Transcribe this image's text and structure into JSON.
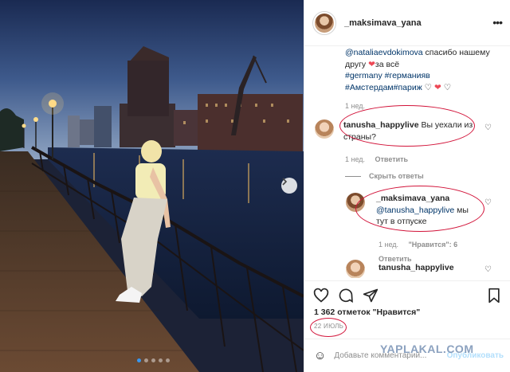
{
  "post": {
    "username": "_maksimava_yana",
    "more_icon": "ellipsis-icon",
    "carousel_next_icon": "chevron-right-icon",
    "carousel_dots": 5,
    "carousel_active": 1
  },
  "caption": {
    "mention": "@nataliaevdokimova",
    "text1": " спасибо нашему другу ",
    "text2": "за всё",
    "tag1": "#germany",
    "tag2": "#германия",
    "tag2_tail": "в",
    "tag3": "#Амстердам",
    "tag4": "#париж",
    "time": "1 нед."
  },
  "comment1": {
    "user": "tanusha_happylive",
    "text": " Вы уехали из страны?",
    "time": "1 нед.",
    "reply": "Ответить"
  },
  "hide_replies": "Скрыть ответы",
  "reply1": {
    "user": "_maksimava_yana",
    "mention": "@tanusha_happylive",
    "text": " мы тут в отпуске",
    "time": "1 нед.",
    "likes": "\"Нравится\": 6",
    "reply": "Ответить"
  },
  "comment2": {
    "user": "tanusha_happylive"
  },
  "stats": {
    "likes": "1 362 отметок \"Нравится\"",
    "date": "22 ИЮЛЬ"
  },
  "add_comment": {
    "placeholder": "Добавьте комментарий...",
    "publish": "Опубликовать"
  },
  "watermark": "YAPLAKAL.COM",
  "colors": {
    "link": "#003569",
    "annotation": "#d2143a",
    "heart": "#ed4956",
    "meta": "#8e8e8e"
  }
}
